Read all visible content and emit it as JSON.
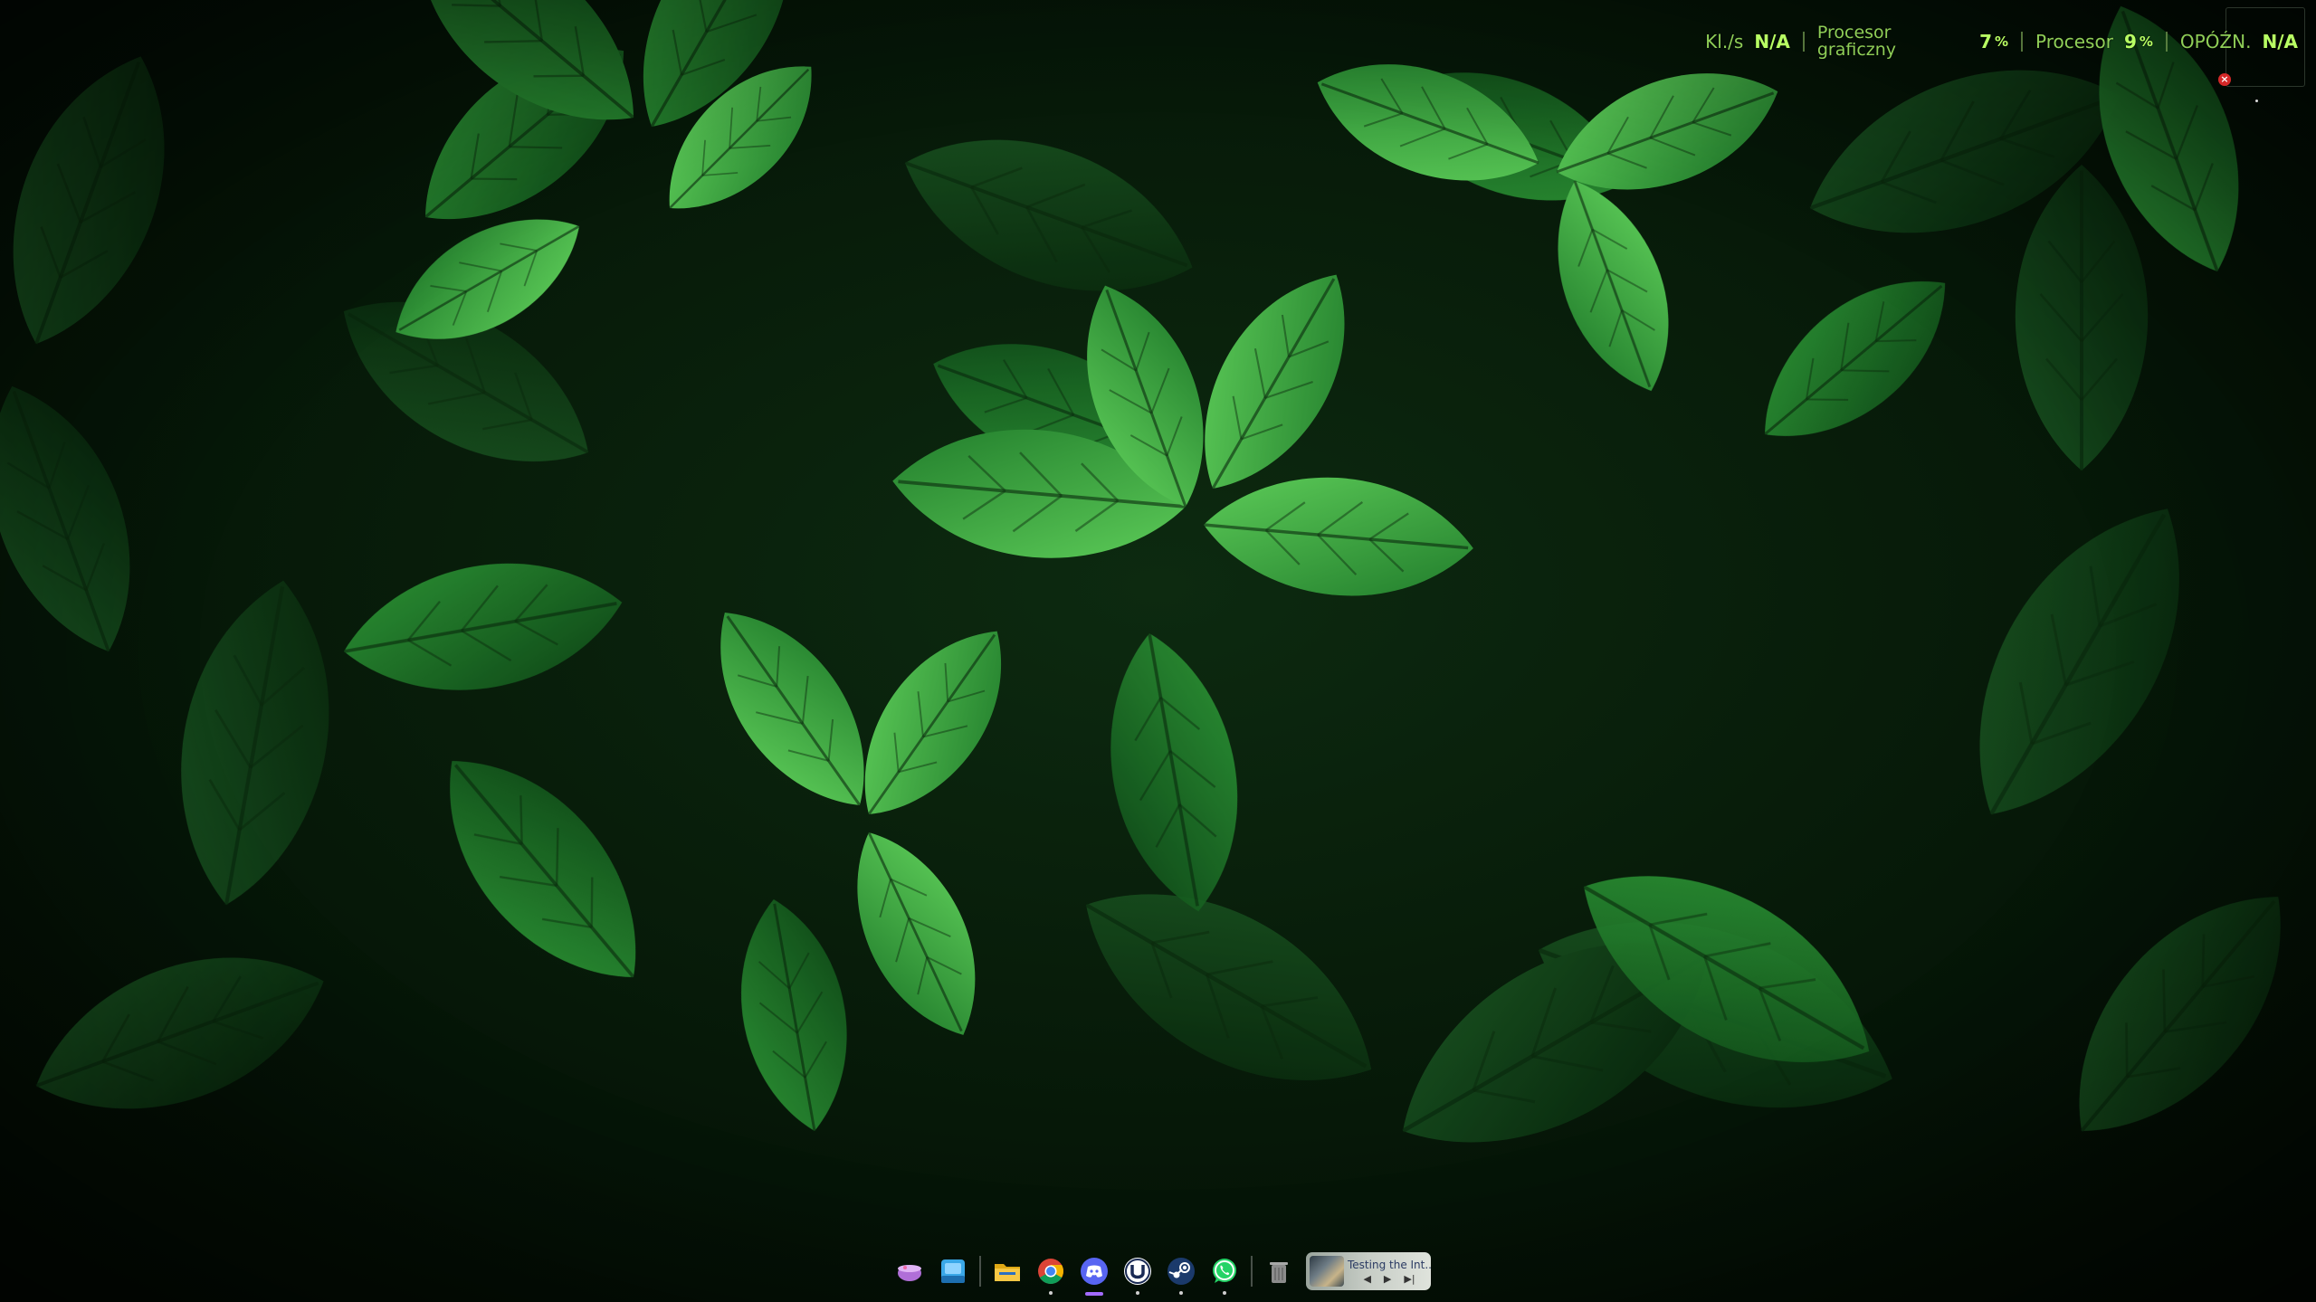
{
  "overlay": {
    "fps_label": "Kl./s",
    "fps_value": "N/A",
    "gpu_label_line1": "Procesor",
    "gpu_label_line2": "graficzny",
    "gpu_value": "7",
    "gpu_unit": "%",
    "cpu_label": "Procesor",
    "cpu_value": "9",
    "cpu_unit": "%",
    "latency_label": "OPÓŹN.",
    "latency_value": "N/A",
    "close_glyph": "×"
  },
  "dock": {
    "items": [
      {
        "name": "app-launcher",
        "icon": "bowl-icon",
        "running": false
      },
      {
        "name": "file-manager-blue",
        "icon": "window-icon",
        "running": false
      },
      {
        "name": "files",
        "icon": "folder-icon",
        "running": false
      },
      {
        "name": "chrome",
        "icon": "chrome-icon",
        "running": true
      },
      {
        "name": "discord",
        "icon": "discord-icon",
        "running": true,
        "active": true
      },
      {
        "name": "launcher-u",
        "icon": "u-icon",
        "running": true
      },
      {
        "name": "steam",
        "icon": "steam-icon",
        "running": true
      },
      {
        "name": "whatsapp",
        "icon": "whatsapp-icon",
        "running": true
      },
      {
        "name": "trash",
        "icon": "trash-icon",
        "running": false
      }
    ],
    "media": {
      "title": "Testing the Int...",
      "prev": "◀",
      "play": "▶",
      "next": "▶|"
    }
  },
  "colors": {
    "overlay_label": "#8fce57",
    "overlay_value": "#b8ff63",
    "discord": "#5865f2",
    "whatsapp": "#25d366",
    "steam": "#1b3a6b",
    "active_indicator": "#a36bff"
  }
}
